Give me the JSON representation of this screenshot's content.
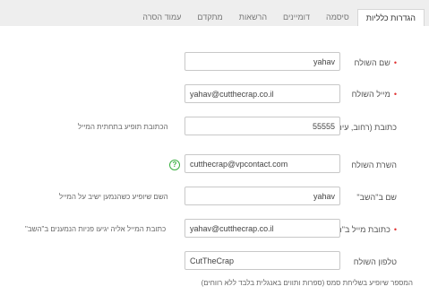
{
  "tabs": [
    {
      "label": "הגדרות כלליות",
      "active": true
    },
    {
      "label": "סיסמה",
      "active": false
    },
    {
      "label": "דומיינים",
      "active": false
    },
    {
      "label": "הרשאות",
      "active": false
    },
    {
      "label": "מתקדם",
      "active": false
    },
    {
      "label": "עמוד הסרה",
      "active": false
    }
  ],
  "form": {
    "sender_name": {
      "label": "שם השולח",
      "required": true,
      "value": "yahav"
    },
    "sender_email": {
      "label": "מייל השולח",
      "required": true,
      "value": "yahav@cutthecrap.co.il"
    },
    "address": {
      "label": "כתובת (רחוב, עיר)",
      "required": false,
      "value": "55555",
      "hint": "הכתובת תופיע בתחתית המייל"
    },
    "sender_server": {
      "label": "השרת השולח",
      "required": false,
      "value": "cutthecrap@vpcontact.com",
      "help_icon": "?"
    },
    "reply_name": {
      "label": "שם ב\"השב\"",
      "required": false,
      "value": "yahav",
      "hint": "השם שיופיע כשהנמען ישיב על המייל"
    },
    "reply_email": {
      "label": "כתובת מייל ב\"השב\"",
      "required": true,
      "value": "yahav@cutthecrap.co.il",
      "hint": "כתובת המייל אליה יגיעו פניות הנמענים ב\"השב\""
    },
    "sender_phone": {
      "label": "טלפון השולח",
      "required": false,
      "value": "CutTheCrap",
      "hint": "המספר שיופיע בשליחת סמס (ספרות ותווים באנגלית בלבד ללא רווחים)"
    }
  },
  "colors": {
    "required_marker": "#e03131",
    "help_icon": "#3cb043",
    "tab_bar_bg": "#eeeeee"
  }
}
